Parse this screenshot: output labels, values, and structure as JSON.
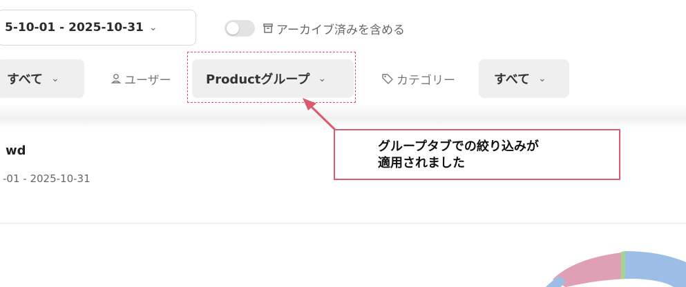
{
  "date_range": {
    "value": "5-10-01 - 2025-10-31"
  },
  "archive_toggle": {
    "label": "アーカイブ済みを含める",
    "on": false
  },
  "filters": {
    "first_value": "すべて",
    "user_label": "ユーザー",
    "user_value": "Productグループ",
    "category_label": "カテゴリー",
    "category_value": "すべて"
  },
  "section": {
    "title": "wd",
    "subtitle": "-01 - 2025-10-31"
  },
  "annotation": {
    "line1": "グループタブでの絞り込みが",
    "line2": "適用されました"
  },
  "donut_colors": {
    "blue": "#9cbde6",
    "pink": "#dfa0b5",
    "green": "#a5d48e"
  },
  "accent_annotation": "#d95b6d"
}
